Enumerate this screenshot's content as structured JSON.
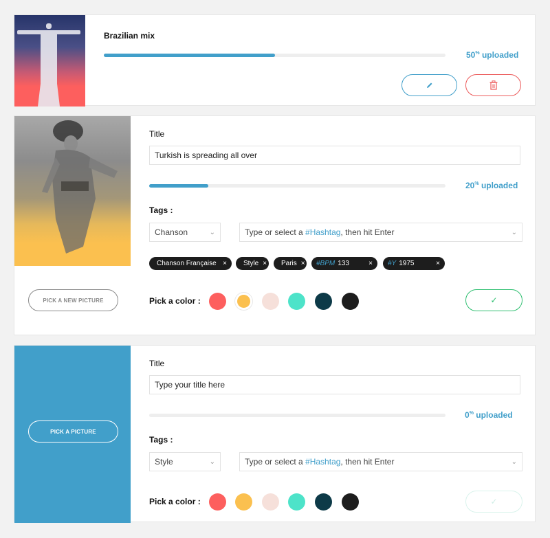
{
  "card1": {
    "title": "Brazilian mix",
    "progress": 0.5,
    "pct_value": "50",
    "pct_unit": "%",
    "pct_label": "uploaded",
    "edit_icon": "pencil-icon",
    "delete_icon": "trash-icon"
  },
  "card2": {
    "title_label": "Title",
    "title_value": "Turkish is spreading all over",
    "progress": 0.2,
    "pct_value": "20",
    "pct_unit": "%",
    "pct_label": "uploaded",
    "tags_label": "Tags :",
    "category": "Chanson",
    "hashtag_prefix": "Type or select a ",
    "hashtag_word": "#Hashtag",
    "hashtag_suffix": ", then hit Enter",
    "tags": [
      {
        "hash": "",
        "text": "Chanson Française"
      },
      {
        "hash": "",
        "text": "Style"
      },
      {
        "hash": "",
        "text": "Paris"
      },
      {
        "hash": "#BPM",
        "text": "133"
      },
      {
        "hash": "#Y",
        "text": "1975"
      }
    ],
    "tag_remove": "×",
    "pick_picture": "PICK A NEW PICTURE",
    "color_label": "Pick a color :",
    "colors": [
      "#fd5f5e",
      "#fbc04f",
      "#f6e0da",
      "#4de3c9",
      "#0d3a48",
      "#1d1d1d"
    ],
    "selected_color": "#fbc04f",
    "confirm": "✓",
    "confirm_color": "#2fbf71"
  },
  "card3": {
    "title_label": "Title",
    "title_placeholder": "Type your title here",
    "progress": 0,
    "pct_value": "0",
    "pct_unit": "%",
    "pct_label": "uploaded",
    "tags_label": "Tags :",
    "category": "Style",
    "hashtag_prefix": "Type or select a ",
    "hashtag_word": "#Hashtag",
    "hashtag_suffix": ", then hit Enter",
    "pick_picture": "PICK A PICTURE",
    "color_label": "Pick a color :",
    "colors": [
      "#fd5f5e",
      "#fbc04f",
      "#f6e0da",
      "#4de3c9",
      "#0d3a48",
      "#1d1d1d"
    ],
    "confirm": "✓",
    "panel_color": "#419fca"
  },
  "chevron": "⌄"
}
